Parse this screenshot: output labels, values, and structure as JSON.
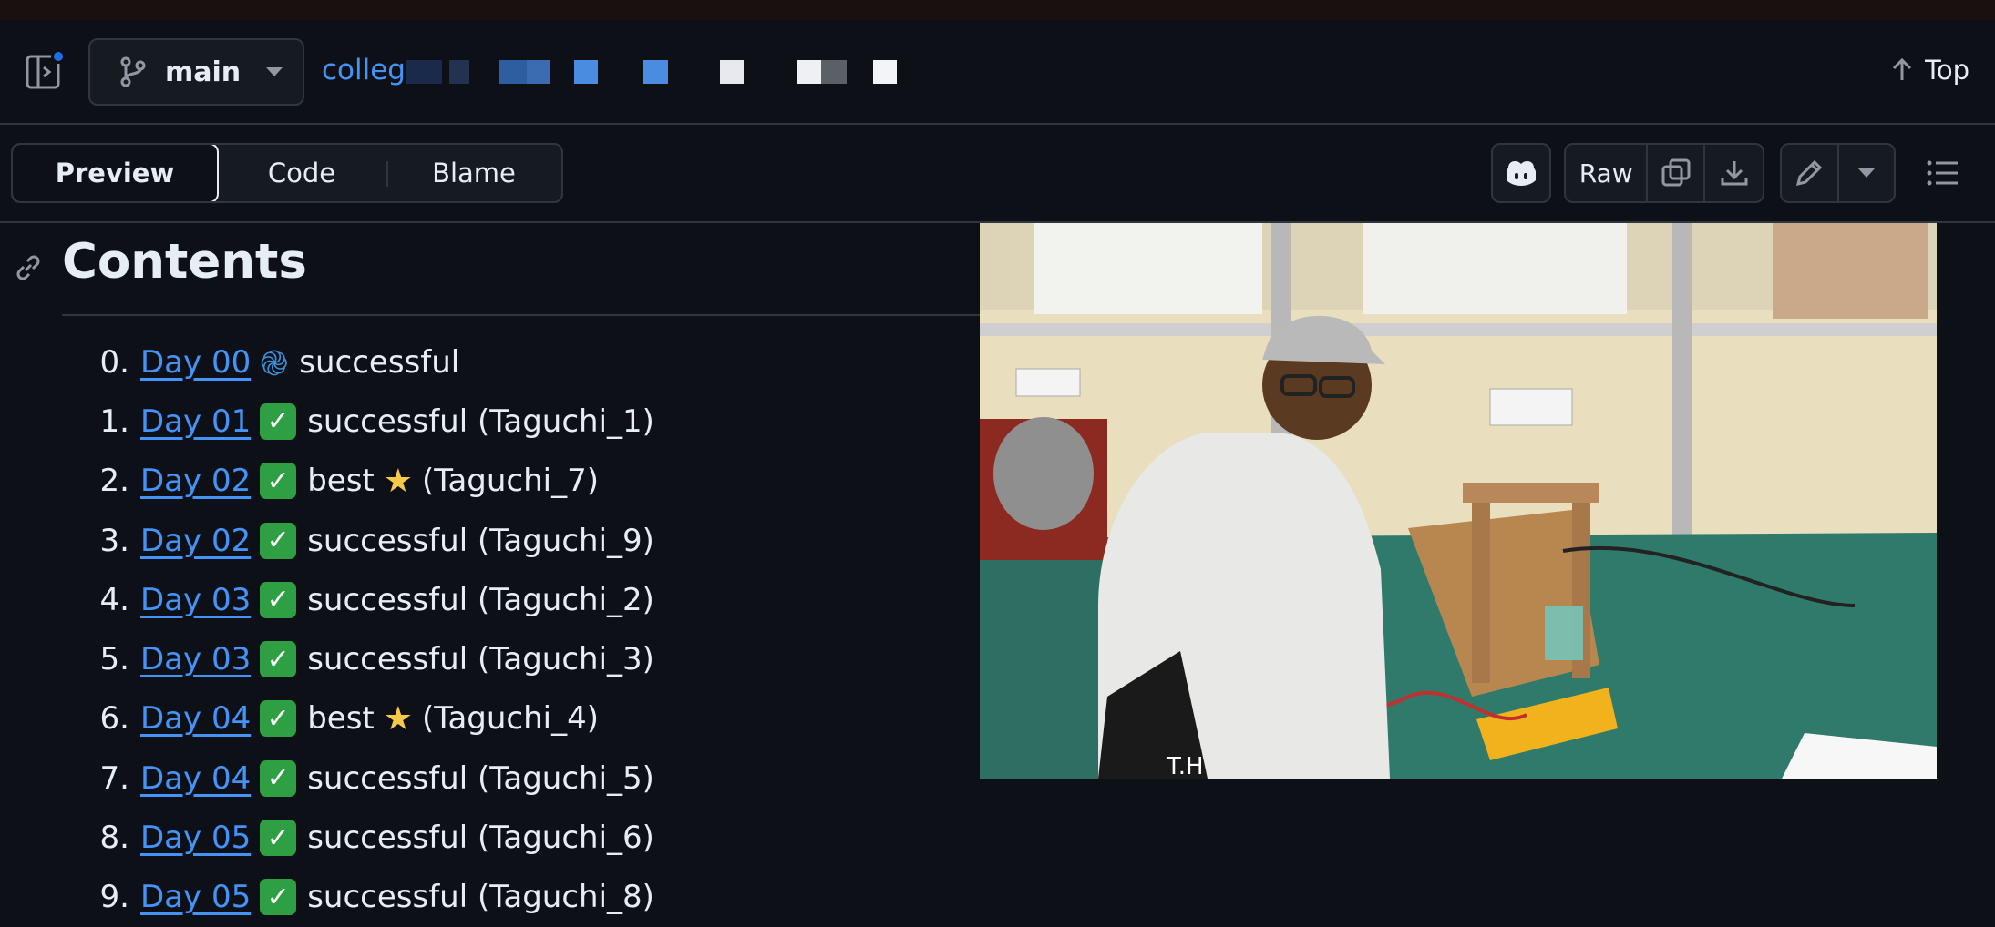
{
  "header": {
    "branch": "main",
    "breadcrumb_visible": "colleg",
    "top_label": "Top"
  },
  "toolbar": {
    "tabs": [
      "Preview",
      "Code",
      "Blame"
    ],
    "raw_label": "Raw"
  },
  "content": {
    "heading": "Contents",
    "items": [
      {
        "num": "0.",
        "link": "Day 00",
        "icon": "swirl",
        "text": "successful"
      },
      {
        "num": "1.",
        "link": "Day 01",
        "icon": "check",
        "text": "successful (Taguchi_1)"
      },
      {
        "num": "2.",
        "link": "Day 02",
        "icon": "check",
        "text": "best",
        "star": true,
        "after": "(Taguchi_7)"
      },
      {
        "num": "3.",
        "link": "Day 02",
        "icon": "check",
        "text": "successful (Taguchi_9)"
      },
      {
        "num": "4.",
        "link": "Day 03",
        "icon": "check",
        "text": "successful (Taguchi_2)"
      },
      {
        "num": "5.",
        "link": "Day 03",
        "icon": "check",
        "text": "successful (Taguchi_3)"
      },
      {
        "num": "6.",
        "link": "Day 04",
        "icon": "check",
        "text": "best",
        "star": true,
        "after": "(Taguchi_4)"
      },
      {
        "num": "7.",
        "link": "Day 04",
        "icon": "check",
        "text": "successful (Taguchi_5)"
      },
      {
        "num": "8.",
        "link": "Day 05",
        "icon": "check",
        "text": "successful (Taguchi_6)"
      },
      {
        "num": "9.",
        "link": "Day 05",
        "icon": "check",
        "text": "successful (Taguchi_8)"
      }
    ],
    "photo": {
      "label_on_table": "T.H"
    }
  },
  "icons": {
    "sidebar": "sidebar-toggle-icon",
    "branch": "git-branch-icon",
    "copilot": "copilot-icon",
    "copy": "copy-icon",
    "download": "download-icon",
    "edit": "pencil-icon",
    "outline": "list-icon"
  },
  "colors": {
    "link": "#4493f8",
    "check": "#2ea043",
    "star": "#f7c948",
    "accent": "#1f6feb"
  }
}
